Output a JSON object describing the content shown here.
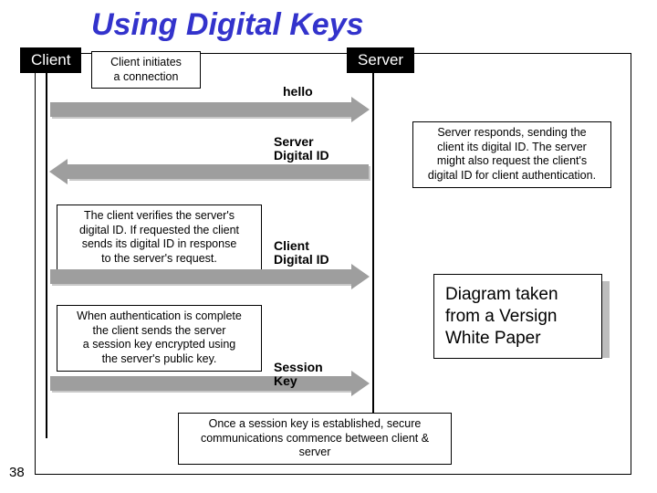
{
  "title": "Using Digital Keys",
  "page_number": "38",
  "client_label": "Client",
  "server_label": "Server",
  "boxes": {
    "initiate": "Client initiates\na connection",
    "server_responds": "Server responds, sending the\nclient its digital ID.  The server\nmight also request the client's\ndigital ID for client authentication.",
    "client_verifies": "The client verifies the server's\ndigital ID.  If requested the client\nsends its digital ID in response\nto the server's request.",
    "auth_complete": "When authentication is complete\nthe client sends the server\na session key encrypted using\nthe server's public key.",
    "footer": "Once a session key is established, secure\ncommunications commence between client & server"
  },
  "messages": {
    "hello": "hello",
    "server_id": "Server\nDigital ID",
    "client_id": "Client\nDigital ID",
    "session_key": "Session\nKey"
  },
  "caption": "Diagram taken\nfrom a Versign\nWhite Paper"
}
